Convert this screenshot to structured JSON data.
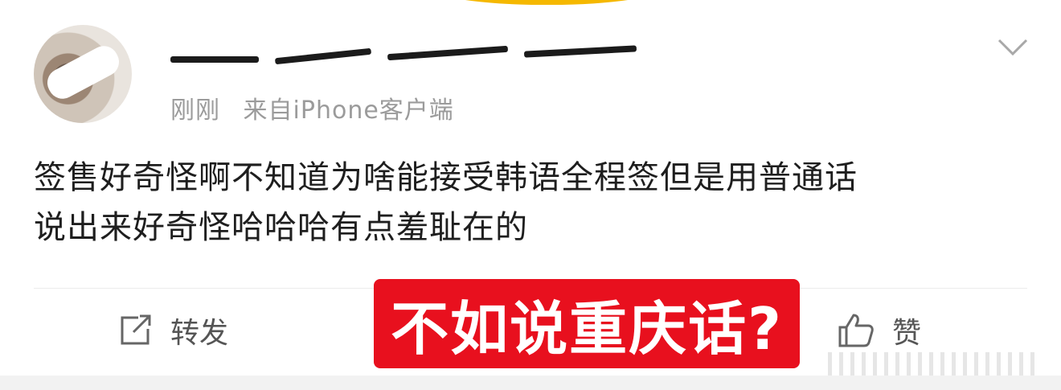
{
  "post": {
    "meta": {
      "time": "刚刚",
      "source": "来自iPhone客户端"
    },
    "content_lines": [
      "签售好奇怪啊不知道为啥能接受韩语全程签但是用普通话",
      "说出来好奇怪哈哈哈有点羞耻在的"
    ]
  },
  "actions": {
    "forward_label": "转发",
    "like_label": "赞"
  },
  "overlay_caption": "不如说重庆话?",
  "colors": {
    "overlay_bg": "#e8101e",
    "accent": "#f5b800",
    "meta_text": "#9b9b9b"
  },
  "icons": {
    "forward": "forward-icon",
    "like": "thumbs-up-icon",
    "more": "chevron-down-icon"
  }
}
